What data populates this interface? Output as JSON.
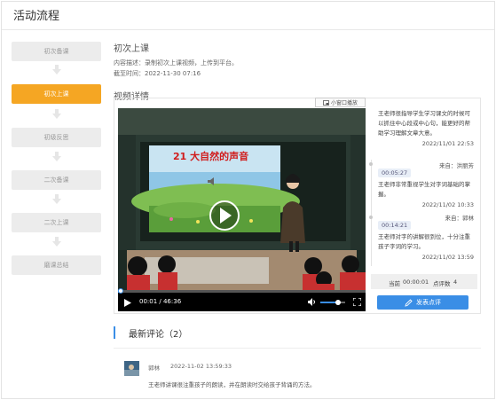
{
  "page": {
    "title": "活动流程"
  },
  "steps": [
    {
      "label": "初次备课"
    },
    {
      "label": "初次上课",
      "active": true
    },
    {
      "label": "初级反思"
    },
    {
      "label": "二次备课"
    },
    {
      "label": "二次上课"
    },
    {
      "label": "磨课总结"
    }
  ],
  "section": {
    "title": "初次上课",
    "description": "内容描述：录制初次上课视频，上传到平台。",
    "deadline": "截至时间：2022-11-30 07:16"
  },
  "video": {
    "heading": "视频详情",
    "mini_window_label": "小窗口播放",
    "slide_text": "21 大自然的声音",
    "current_time": "00:01",
    "duration": "46:36",
    "time_display": "00:01 / 46:36",
    "progress_fraction": 0.0,
    "volume_fraction": 0.72
  },
  "comments": [
    {
      "text": "王老师很指导学生学习课文的时候可以抓住中心段或中心句，能更好的帮助学习理解文章大意。",
      "date": "2022/11/01 22:53"
    },
    {
      "time": "00:05:27",
      "from": "来自：洪丽芳",
      "text": "王老师非常重视学生对字词基础的掌握。",
      "date": "2022/11/02 10:33"
    },
    {
      "time": "00:14:21",
      "from": "来自：郭林",
      "text": "王老师对字的讲解很到位，十分注重孩子字词的学习。",
      "date": "2022/11/02 13:59"
    }
  ],
  "status": {
    "current_label": "当前",
    "current_value": "00:00:01",
    "count_label": "点评数",
    "count_value": "4"
  },
  "post_button": {
    "label": "发表点评"
  },
  "latest": {
    "title": "最新评论（2）",
    "user": "郭林",
    "time": "2022-11-02 13:59:33",
    "text": "王老师讲课很注重孩子的朗读，并在朗读时交给孩子背诵的方法。"
  },
  "colors": {
    "accent": "#3a8ee6",
    "active_step": "#f5a623",
    "step_bg": "#ececec"
  }
}
